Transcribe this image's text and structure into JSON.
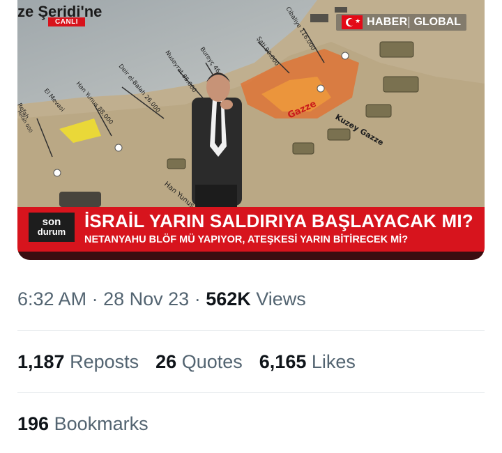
{
  "video": {
    "overlay_title": "ze Şeridi'ne",
    "live_badge": "CANLI",
    "channel_name_1": "HABER",
    "channel_name_2": "GLOBAL",
    "ticker_logo_1": "son",
    "ticker_logo_2": "durum",
    "headline": "İSRAİL YARIN SALDIRIYA BAŞLAYACAK MI?",
    "subheadline": "NETANYAHU BLÖF MÜ YAPIYOR, ATEŞKESİ YARIN BİTİRECEK Mİ?",
    "map_labels": [
      "Refah",
      "El Mevasi",
      "Han Yunus 88.000",
      "Deir el-Balah 26.000",
      "Nuseyrat 85.000",
      "Bureyç 46.000",
      "Şati 90.000",
      "Cibaliye 116.000",
      "Kuzey Gazze",
      "Gazze",
      "Han Yunus",
      "Refah 000"
    ],
    "colors": {
      "ticker_red": "#d7141d",
      "brand_red": "#e30a17"
    }
  },
  "tweet": {
    "time": "6:32 AM",
    "date": "28 Nov 23",
    "views_count": "562K",
    "views_label": "Views",
    "reposts_count": "1,187",
    "reposts_label": "Reposts",
    "quotes_count": "26",
    "quotes_label": "Quotes",
    "likes_count": "6,165",
    "likes_label": "Likes",
    "bookmarks_count": "196",
    "bookmarks_label": "Bookmarks"
  }
}
